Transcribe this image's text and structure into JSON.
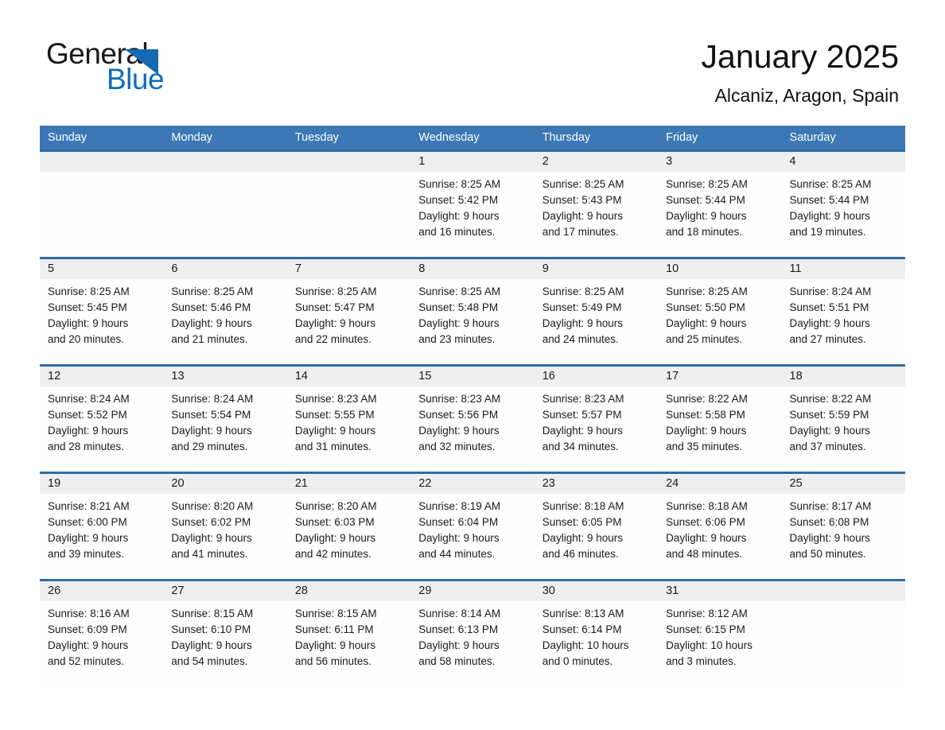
{
  "brand": {
    "name_part1": "General",
    "name_part2": "Blue",
    "logo_icon": "triangle-flag-icon",
    "color_dark": "#1A1A1A",
    "color_blue": "#0E6CB6"
  },
  "header": {
    "title": "January 2025",
    "subtitle": "Alcaniz, Aragon, Spain"
  },
  "theme": {
    "header_blue": "#3B78B5",
    "separator_blue": "#2F6DA8",
    "day_band_gray": "#EFEFEF",
    "text": "#1A1A1A"
  },
  "weekdays": [
    "Sunday",
    "Monday",
    "Tuesday",
    "Wednesday",
    "Thursday",
    "Friday",
    "Saturday"
  ],
  "weeks": [
    [
      {
        "day": "",
        "sunrise": "",
        "sunset": "",
        "daylight1": "",
        "daylight2": ""
      },
      {
        "day": "",
        "sunrise": "",
        "sunset": "",
        "daylight1": "",
        "daylight2": ""
      },
      {
        "day": "",
        "sunrise": "",
        "sunset": "",
        "daylight1": "",
        "daylight2": ""
      },
      {
        "day": "1",
        "sunrise": "Sunrise: 8:25 AM",
        "sunset": "Sunset: 5:42 PM",
        "daylight1": "Daylight: 9 hours",
        "daylight2": "and 16 minutes."
      },
      {
        "day": "2",
        "sunrise": "Sunrise: 8:25 AM",
        "sunset": "Sunset: 5:43 PM",
        "daylight1": "Daylight: 9 hours",
        "daylight2": "and 17 minutes."
      },
      {
        "day": "3",
        "sunrise": "Sunrise: 8:25 AM",
        "sunset": "Sunset: 5:44 PM",
        "daylight1": "Daylight: 9 hours",
        "daylight2": "and 18 minutes."
      },
      {
        "day": "4",
        "sunrise": "Sunrise: 8:25 AM",
        "sunset": "Sunset: 5:44 PM",
        "daylight1": "Daylight: 9 hours",
        "daylight2": "and 19 minutes."
      }
    ],
    [
      {
        "day": "5",
        "sunrise": "Sunrise: 8:25 AM",
        "sunset": "Sunset: 5:45 PM",
        "daylight1": "Daylight: 9 hours",
        "daylight2": "and 20 minutes."
      },
      {
        "day": "6",
        "sunrise": "Sunrise: 8:25 AM",
        "sunset": "Sunset: 5:46 PM",
        "daylight1": "Daylight: 9 hours",
        "daylight2": "and 21 minutes."
      },
      {
        "day": "7",
        "sunrise": "Sunrise: 8:25 AM",
        "sunset": "Sunset: 5:47 PM",
        "daylight1": "Daylight: 9 hours",
        "daylight2": "and 22 minutes."
      },
      {
        "day": "8",
        "sunrise": "Sunrise: 8:25 AM",
        "sunset": "Sunset: 5:48 PM",
        "daylight1": "Daylight: 9 hours",
        "daylight2": "and 23 minutes."
      },
      {
        "day": "9",
        "sunrise": "Sunrise: 8:25 AM",
        "sunset": "Sunset: 5:49 PM",
        "daylight1": "Daylight: 9 hours",
        "daylight2": "and 24 minutes."
      },
      {
        "day": "10",
        "sunrise": "Sunrise: 8:25 AM",
        "sunset": "Sunset: 5:50 PM",
        "daylight1": "Daylight: 9 hours",
        "daylight2": "and 25 minutes."
      },
      {
        "day": "11",
        "sunrise": "Sunrise: 8:24 AM",
        "sunset": "Sunset: 5:51 PM",
        "daylight1": "Daylight: 9 hours",
        "daylight2": "and 27 minutes."
      }
    ],
    [
      {
        "day": "12",
        "sunrise": "Sunrise: 8:24 AM",
        "sunset": "Sunset: 5:52 PM",
        "daylight1": "Daylight: 9 hours",
        "daylight2": "and 28 minutes."
      },
      {
        "day": "13",
        "sunrise": "Sunrise: 8:24 AM",
        "sunset": "Sunset: 5:54 PM",
        "daylight1": "Daylight: 9 hours",
        "daylight2": "and 29 minutes."
      },
      {
        "day": "14",
        "sunrise": "Sunrise: 8:23 AM",
        "sunset": "Sunset: 5:55 PM",
        "daylight1": "Daylight: 9 hours",
        "daylight2": "and 31 minutes."
      },
      {
        "day": "15",
        "sunrise": "Sunrise: 8:23 AM",
        "sunset": "Sunset: 5:56 PM",
        "daylight1": "Daylight: 9 hours",
        "daylight2": "and 32 minutes."
      },
      {
        "day": "16",
        "sunrise": "Sunrise: 8:23 AM",
        "sunset": "Sunset: 5:57 PM",
        "daylight1": "Daylight: 9 hours",
        "daylight2": "and 34 minutes."
      },
      {
        "day": "17",
        "sunrise": "Sunrise: 8:22 AM",
        "sunset": "Sunset: 5:58 PM",
        "daylight1": "Daylight: 9 hours",
        "daylight2": "and 35 minutes."
      },
      {
        "day": "18",
        "sunrise": "Sunrise: 8:22 AM",
        "sunset": "Sunset: 5:59 PM",
        "daylight1": "Daylight: 9 hours",
        "daylight2": "and 37 minutes."
      }
    ],
    [
      {
        "day": "19",
        "sunrise": "Sunrise: 8:21 AM",
        "sunset": "Sunset: 6:00 PM",
        "daylight1": "Daylight: 9 hours",
        "daylight2": "and 39 minutes."
      },
      {
        "day": "20",
        "sunrise": "Sunrise: 8:20 AM",
        "sunset": "Sunset: 6:02 PM",
        "daylight1": "Daylight: 9 hours",
        "daylight2": "and 41 minutes."
      },
      {
        "day": "21",
        "sunrise": "Sunrise: 8:20 AM",
        "sunset": "Sunset: 6:03 PM",
        "daylight1": "Daylight: 9 hours",
        "daylight2": "and 42 minutes."
      },
      {
        "day": "22",
        "sunrise": "Sunrise: 8:19 AM",
        "sunset": "Sunset: 6:04 PM",
        "daylight1": "Daylight: 9 hours",
        "daylight2": "and 44 minutes."
      },
      {
        "day": "23",
        "sunrise": "Sunrise: 8:18 AM",
        "sunset": "Sunset: 6:05 PM",
        "daylight1": "Daylight: 9 hours",
        "daylight2": "and 46 minutes."
      },
      {
        "day": "24",
        "sunrise": "Sunrise: 8:18 AM",
        "sunset": "Sunset: 6:06 PM",
        "daylight1": "Daylight: 9 hours",
        "daylight2": "and 48 minutes."
      },
      {
        "day": "25",
        "sunrise": "Sunrise: 8:17 AM",
        "sunset": "Sunset: 6:08 PM",
        "daylight1": "Daylight: 9 hours",
        "daylight2": "and 50 minutes."
      }
    ],
    [
      {
        "day": "26",
        "sunrise": "Sunrise: 8:16 AM",
        "sunset": "Sunset: 6:09 PM",
        "daylight1": "Daylight: 9 hours",
        "daylight2": "and 52 minutes."
      },
      {
        "day": "27",
        "sunrise": "Sunrise: 8:15 AM",
        "sunset": "Sunset: 6:10 PM",
        "daylight1": "Daylight: 9 hours",
        "daylight2": "and 54 minutes."
      },
      {
        "day": "28",
        "sunrise": "Sunrise: 8:15 AM",
        "sunset": "Sunset: 6:11 PM",
        "daylight1": "Daylight: 9 hours",
        "daylight2": "and 56 minutes."
      },
      {
        "day": "29",
        "sunrise": "Sunrise: 8:14 AM",
        "sunset": "Sunset: 6:13 PM",
        "daylight1": "Daylight: 9 hours",
        "daylight2": "and 58 minutes."
      },
      {
        "day": "30",
        "sunrise": "Sunrise: 8:13 AM",
        "sunset": "Sunset: 6:14 PM",
        "daylight1": "Daylight: 10 hours",
        "daylight2": "and 0 minutes."
      },
      {
        "day": "31",
        "sunrise": "Sunrise: 8:12 AM",
        "sunset": "Sunset: 6:15 PM",
        "daylight1": "Daylight: 10 hours",
        "daylight2": "and 3 minutes."
      },
      {
        "day": "",
        "sunrise": "",
        "sunset": "",
        "daylight1": "",
        "daylight2": ""
      }
    ]
  ]
}
